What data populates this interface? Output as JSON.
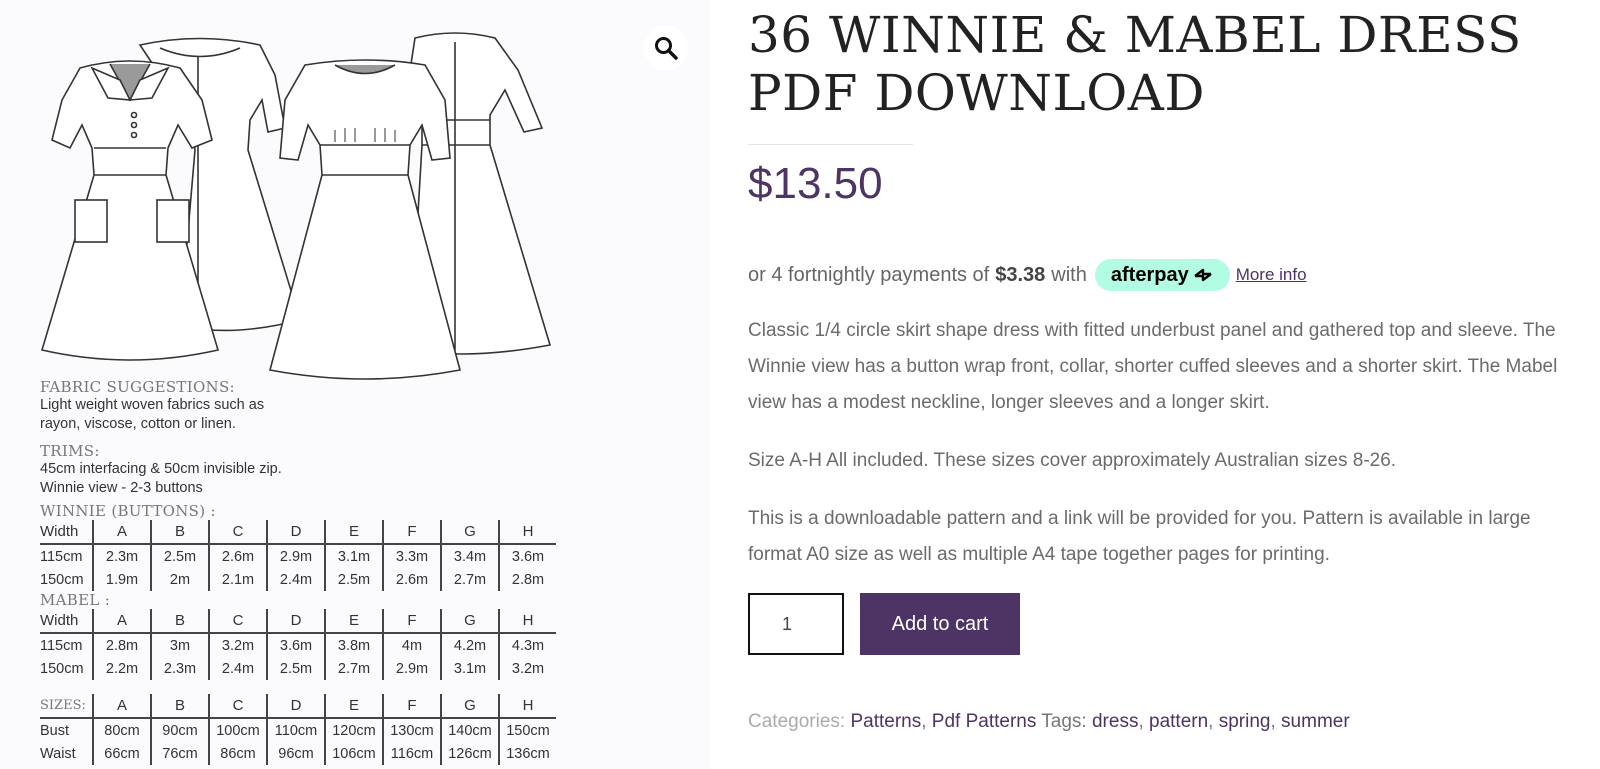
{
  "product": {
    "title": "36 WINNIE & MABEL DRESS PDF DOWNLOAD",
    "price": "$13.50",
    "afterpay": {
      "prefix": "or 4 fortnightly payments of",
      "amount": "$3.38",
      "with": "with",
      "brand": "afterpay",
      "more_info": "More info"
    },
    "description": [
      "Classic 1/4 circle skirt shape dress with fitted underbust panel and gathered top and sleeve. The Winnie view has a button wrap front, collar, shorter cuffed sleeves and a shorter skirt. The Mabel view has a modest neckline, longer sleeves and a longer skirt.",
      "Size A-H All included. These sizes cover approximately Australian sizes 8-26.",
      "This is a downloadable pattern and a link will be provided for you. Pattern is available in large format A0 size as well as multiple A4 tape together pages for printing."
    ],
    "quantity": "1",
    "add_to_cart": "Add to cart",
    "meta": {
      "categories_label": "Categories:",
      "categories": [
        "Patterns",
        "Pdf Patterns"
      ],
      "tags_label": "Tags:",
      "tags": [
        "dress",
        "pattern",
        "spring",
        "summer"
      ]
    }
  },
  "gallery": {
    "zoom_icon": "magnifier-icon",
    "fabric_heading": "FABRIC SUGGESTIONS:",
    "fabric_text_1": "Light weight woven fabrics such as",
    "fabric_text_2": "rayon, viscose, cotton or linen.",
    "trims_heading": "TRIMS:",
    "trims_text_1": "45cm interfacing & 50cm invisible zip.",
    "trims_text_2": "Winnie view - 2-3 buttons",
    "winnie_heading": "WINNIE (BUTTONS) :",
    "mabel_heading": "MABEL :",
    "sizes_label": "SIZES:",
    "columns": [
      "A",
      "B",
      "C",
      "D",
      "E",
      "F",
      "G",
      "H"
    ],
    "width_label": "Width",
    "winnie_rows": [
      {
        "label": "115cm",
        "values": [
          "2.3m",
          "2.5m",
          "2.6m",
          "2.9m",
          "3.1m",
          "3.3m",
          "3.4m",
          "3.6m"
        ]
      },
      {
        "label": "150cm",
        "values": [
          "1.9m",
          "2m",
          "2.1m",
          "2.4m",
          "2.5m",
          "2.6m",
          "2.7m",
          "2.8m"
        ]
      }
    ],
    "mabel_rows": [
      {
        "label": "115cm",
        "values": [
          "2.8m",
          "3m",
          "3.2m",
          "3.6m",
          "3.8m",
          "4m",
          "4.2m",
          "4.3m"
        ]
      },
      {
        "label": "150cm",
        "values": [
          "2.2m",
          "2.3m",
          "2.4m",
          "2.5m",
          "2.7m",
          "2.9m",
          "3.1m",
          "3.2m"
        ]
      }
    ],
    "size_rows": [
      {
        "label": "Bust",
        "values": [
          "80cm",
          "90cm",
          "100cm",
          "110cm",
          "120cm",
          "130cm",
          "140cm",
          "150cm"
        ]
      },
      {
        "label": "Waist",
        "values": [
          "66cm",
          "76cm",
          "86cm",
          "96cm",
          "106cm",
          "116cm",
          "126cm",
          "136cm"
        ]
      }
    ]
  }
}
